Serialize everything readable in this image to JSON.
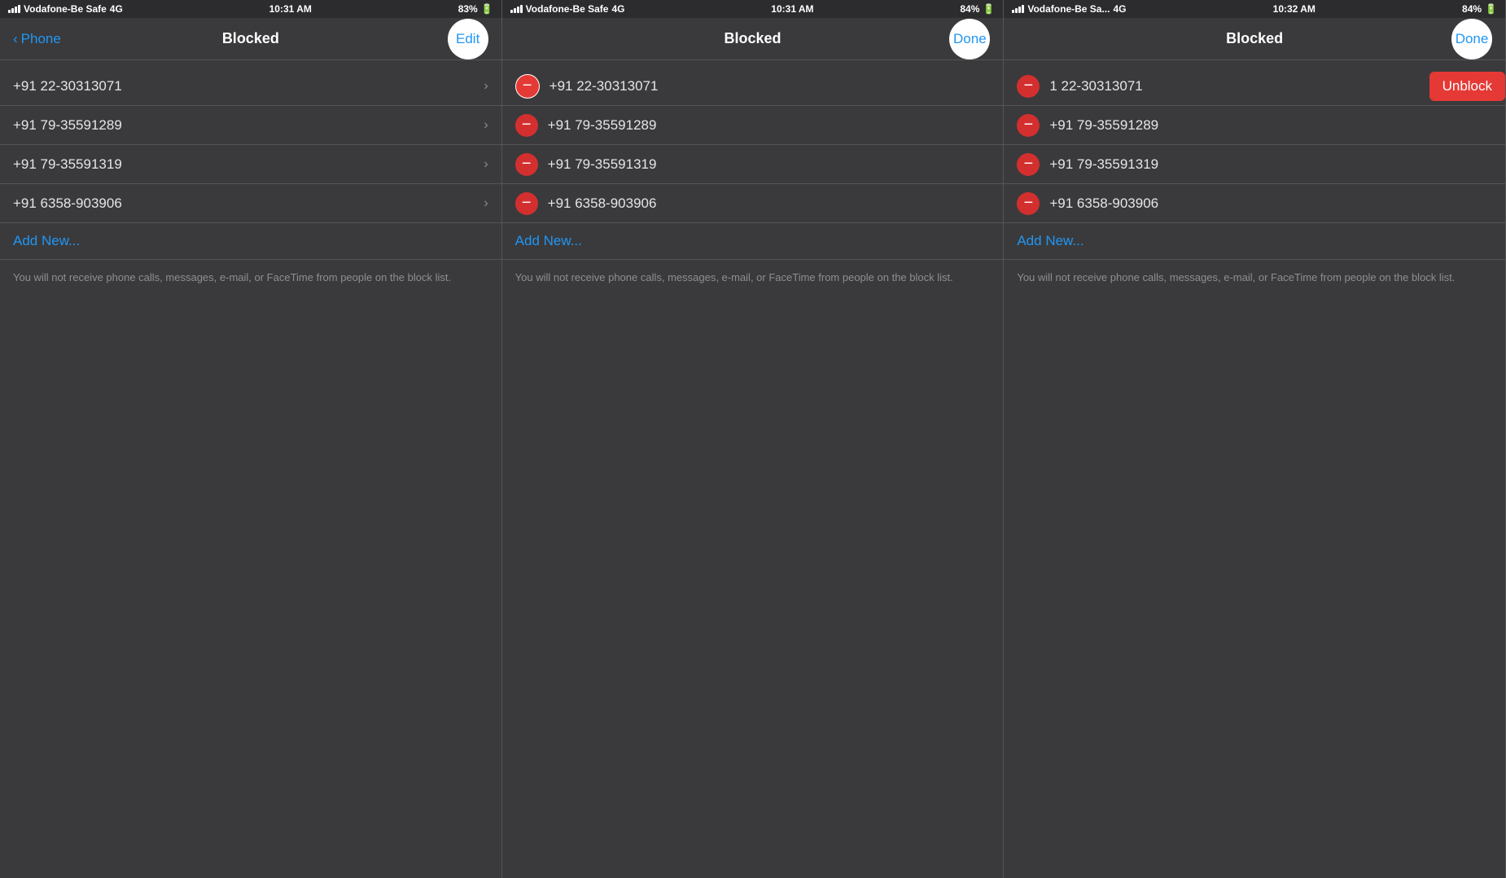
{
  "panels": [
    {
      "id": "panel1",
      "status": {
        "carrier": "Vodafone-Be Safe",
        "network": "4G",
        "time": "10:31 AM",
        "battery": "83%"
      },
      "nav": {
        "back_label": "Phone",
        "title": "Blocked",
        "right_label": "Edit"
      },
      "contacts": [
        {
          "number": "+91 22-30313071"
        },
        {
          "number": "+91 79-35591289"
        },
        {
          "number": "+91 79-35591319"
        },
        {
          "number": "+91 6358-903906"
        }
      ],
      "add_new": "Add New...",
      "footer": "You will not receive phone calls, messages, e-mail, or FaceTime from people on the block list."
    },
    {
      "id": "panel2",
      "status": {
        "carrier": "Vodafone-Be Safe",
        "network": "4G",
        "time": "10:31 AM",
        "battery": "84%"
      },
      "nav": {
        "back_label": "",
        "title": "Blocked",
        "right_label": "Done"
      },
      "contacts": [
        {
          "number": "+91 22-30313071",
          "first": true
        },
        {
          "number": "+91 79-35591289"
        },
        {
          "number": "+91 79-35591319"
        },
        {
          "number": "+91 6358-903906"
        }
      ],
      "add_new": "Add New...",
      "footer": "You will not receive phone calls, messages, e-mail, or FaceTime from people on the block list."
    },
    {
      "id": "panel3",
      "status": {
        "carrier": "Vodafone-Be Sa...",
        "network": "4G",
        "time": "10:32 AM",
        "battery": "84%"
      },
      "nav": {
        "back_label": "",
        "title": "Blocked",
        "right_label": "Done"
      },
      "contacts": [
        {
          "number": "1 22-30313071",
          "unblock": true
        },
        {
          "number": "+91 79-35591289"
        },
        {
          "number": "+91 79-35591319"
        },
        {
          "number": "+91 6358-903906"
        }
      ],
      "add_new": "Add New...",
      "footer": "You will not receive phone calls, messages, e-mail, or FaceTime from people on the block list.",
      "unblock_label": "Unblock"
    }
  ]
}
